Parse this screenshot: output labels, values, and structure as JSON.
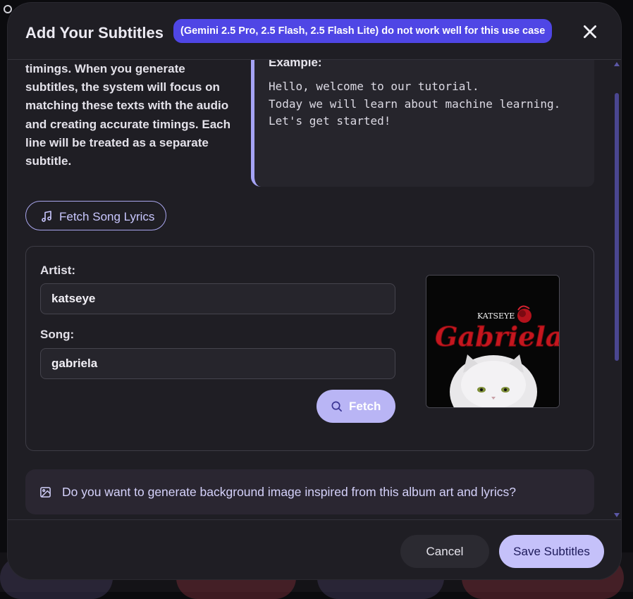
{
  "modal": {
    "title": "Add Your Subtitles",
    "badge": "(Gemini 2.5 Pro, 2.5 Flash, 2.5 Flash Lite) do not work well for this use case",
    "close_icon": "close-icon"
  },
  "description": "timings. When you generate subtitles, the system will focus on matching these texts with the audio and creating accurate timings. Each line will be treated as a separate subtitle.",
  "example": {
    "label": "Example:",
    "lines": "Hello, welcome to our tutorial.\nToday we will learn about machine learning.\nLet's get started!"
  },
  "fetch_lyrics": {
    "label": "Fetch Song Lyrics",
    "icon": "music-note-icon"
  },
  "lyrics_form": {
    "artist_label": "Artist:",
    "artist_value": "katseye",
    "song_label": "Song:",
    "song_value": "gabriela",
    "fetch_label": "Fetch",
    "fetch_icon": "search-icon"
  },
  "album_art": {
    "artist": "KATSEYE",
    "title": "Gabriela"
  },
  "background_prompt": {
    "label": "Do you want to generate background image inspired from this album art and lyrics?",
    "icon": "image-icon"
  },
  "footer": {
    "cancel_label": "Cancel",
    "save_label": "Save Subtitles"
  },
  "colors": {
    "accent": "#4f46e5",
    "primary_button": "#c5c1fa",
    "surface": "#1f1e24"
  }
}
